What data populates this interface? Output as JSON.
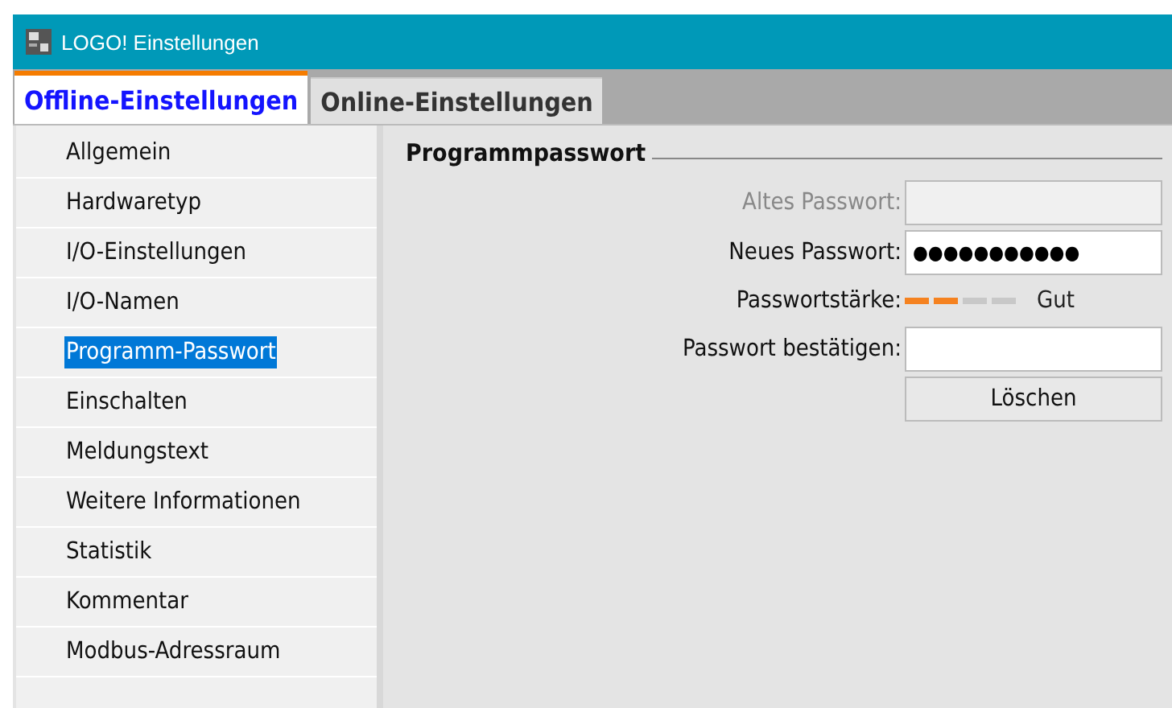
{
  "window": {
    "title": "LOGO! Einstellungen"
  },
  "tabs": [
    {
      "label": "Offline-Einstellungen",
      "selected": true
    },
    {
      "label": "Online-Einstellungen",
      "selected": false
    }
  ],
  "sidebar": {
    "items": [
      {
        "label": "Allgemein",
        "selected": false
      },
      {
        "label": "Hardwaretyp",
        "selected": false
      },
      {
        "label": "I/O-Einstellungen",
        "selected": false
      },
      {
        "label": "I/O-Namen",
        "selected": false
      },
      {
        "label": "Programm-Passwort",
        "selected": true
      },
      {
        "label": "Einschalten",
        "selected": false
      },
      {
        "label": "Meldungstext",
        "selected": false
      },
      {
        "label": "Weitere Informationen",
        "selected": false
      },
      {
        "label": "Statistik",
        "selected": false
      },
      {
        "label": "Kommentar",
        "selected": false
      },
      {
        "label": "Modbus-Adressraum",
        "selected": false
      }
    ]
  },
  "group": {
    "title": "Programmpasswort",
    "fields": [
      {
        "kind": "input",
        "label": "Altes Passwort:",
        "disabled": true
      },
      {
        "kind": "input",
        "label": "Neues Passwort:",
        "disabled": false,
        "value": "●●●●●●●●●●●"
      },
      {
        "kind": "strength",
        "label": "Passwortstärke:",
        "level": 0.5,
        "reading": "Gut"
      },
      {
        "kind": "input",
        "label": "Passwort bestätigen:",
        "disabled": false
      },
      {
        "kind": "button",
        "label": "Löschen"
      }
    ]
  }
}
